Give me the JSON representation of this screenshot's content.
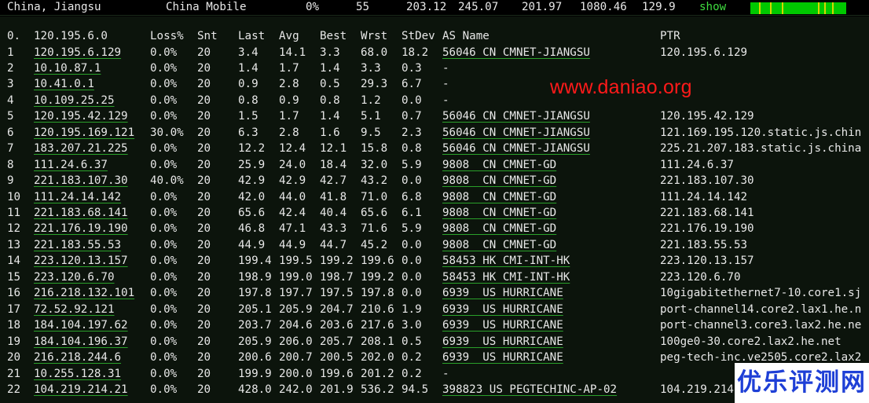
{
  "header": {
    "location": "China, Jiangsu",
    "isp": "China Mobile",
    "loss": "0%",
    "snt": "55",
    "last": "203.12",
    "avg": "245.07",
    "best": "201.97",
    "wrst": "1080.46",
    "stdev": "129.9",
    "show_label": "show"
  },
  "colors": {
    "background": "#000000",
    "panel": "#0c140c",
    "link_underline": "#2aa02a",
    "show_link": "#3fdc3f",
    "sparkline": "#00c800",
    "sparkline_spike": "#d6d600",
    "watermark": "#ff1a1a",
    "logo": "#1e3fd6"
  },
  "table": {
    "columns": {
      "hop": "0.",
      "host": "120.195.6.0",
      "loss": "Loss%",
      "snt": "Snt",
      "last": "Last",
      "avg": "Avg",
      "best": "Best",
      "wrst": "Wrst",
      "stdev": "StDev",
      "as": "AS Name",
      "ptr": "PTR"
    },
    "rows": [
      {
        "hop": "1",
        "host": "120.195.6.129",
        "loss": "0.0%",
        "snt": "20",
        "last": "3.4",
        "avg": "14.1",
        "best": "3.3",
        "wrst": "68.0",
        "stdev": "18.2",
        "as": "56046 CN CMNET-JIANGSU",
        "ptr": "120.195.6.129"
      },
      {
        "hop": "2",
        "host": "10.10.87.1",
        "loss": "0.0%",
        "snt": "20",
        "last": "1.4",
        "avg": "1.7",
        "best": "1.4",
        "wrst": "3.3",
        "stdev": "0.3",
        "as": "-",
        "ptr": ""
      },
      {
        "hop": "3",
        "host": "10.41.0.1",
        "loss": "0.0%",
        "snt": "20",
        "last": "0.9",
        "avg": "2.8",
        "best": "0.5",
        "wrst": "29.3",
        "stdev": "6.7",
        "as": "-",
        "ptr": ""
      },
      {
        "hop": "4",
        "host": "10.109.25.25",
        "loss": "0.0%",
        "snt": "20",
        "last": "0.8",
        "avg": "0.9",
        "best": "0.8",
        "wrst": "1.2",
        "stdev": "0.0",
        "as": "-",
        "ptr": ""
      },
      {
        "hop": "5",
        "host": "120.195.42.129",
        "loss": "0.0%",
        "snt": "20",
        "last": "1.5",
        "avg": "1.7",
        "best": "1.4",
        "wrst": "5.1",
        "stdev": "0.7",
        "as": "56046 CN CMNET-JIANGSU",
        "ptr": "120.195.42.129"
      },
      {
        "hop": "6",
        "host": "120.195.169.121",
        "loss": "30.0%",
        "snt": "20",
        "last": "6.3",
        "avg": "2.8",
        "best": "1.6",
        "wrst": "9.5",
        "stdev": "2.3",
        "as": "56046 CN CMNET-JIANGSU",
        "ptr": "121.169.195.120.static.js.chin"
      },
      {
        "hop": "7",
        "host": "183.207.21.225",
        "loss": "0.0%",
        "snt": "20",
        "last": "12.2",
        "avg": "12.4",
        "best": "12.1",
        "wrst": "15.8",
        "stdev": "0.8",
        "as": "56046 CN CMNET-JIANGSU",
        "ptr": "225.21.207.183.static.js.china"
      },
      {
        "hop": "8",
        "host": "111.24.6.37",
        "loss": "0.0%",
        "snt": "20",
        "last": "25.9",
        "avg": "24.0",
        "best": "18.4",
        "wrst": "32.0",
        "stdev": "5.9",
        "as": "9808  CN CMNET-GD",
        "ptr": "111.24.6.37"
      },
      {
        "hop": "9",
        "host": "221.183.107.30",
        "loss": "40.0%",
        "snt": "20",
        "last": "42.9",
        "avg": "42.9",
        "best": "42.7",
        "wrst": "43.2",
        "stdev": "0.0",
        "as": "9808  CN CMNET-GD",
        "ptr": "221.183.107.30"
      },
      {
        "hop": "10",
        "host": "111.24.14.142",
        "loss": "0.0%",
        "snt": "20",
        "last": "42.0",
        "avg": "44.0",
        "best": "41.8",
        "wrst": "71.0",
        "stdev": "6.8",
        "as": "9808  CN CMNET-GD",
        "ptr": "111.24.14.142"
      },
      {
        "hop": "11",
        "host": "221.183.68.141",
        "loss": "0.0%",
        "snt": "20",
        "last": "65.6",
        "avg": "42.4",
        "best": "40.4",
        "wrst": "65.6",
        "stdev": "6.1",
        "as": "9808  CN CMNET-GD",
        "ptr": "221.183.68.141"
      },
      {
        "hop": "12",
        "host": "221.176.19.190",
        "loss": "0.0%",
        "snt": "20",
        "last": "46.8",
        "avg": "47.1",
        "best": "43.3",
        "wrst": "71.6",
        "stdev": "5.9",
        "as": "9808  CN CMNET-GD",
        "ptr": "221.176.19.190"
      },
      {
        "hop": "13",
        "host": "221.183.55.53",
        "loss": "0.0%",
        "snt": "20",
        "last": "44.9",
        "avg": "44.9",
        "best": "44.7",
        "wrst": "45.2",
        "stdev": "0.0",
        "as": "9808  CN CMNET-GD",
        "ptr": "221.183.55.53"
      },
      {
        "hop": "14",
        "host": "223.120.13.157",
        "loss": "0.0%",
        "snt": "20",
        "last": "199.4",
        "avg": "199.5",
        "best": "199.2",
        "wrst": "199.6",
        "stdev": "0.0",
        "as": "58453 HK CMI-INT-HK",
        "ptr": "223.120.13.157"
      },
      {
        "hop": "15",
        "host": "223.120.6.70",
        "loss": "0.0%",
        "snt": "20",
        "last": "198.9",
        "avg": "199.0",
        "best": "198.7",
        "wrst": "199.2",
        "stdev": "0.0",
        "as": "58453 HK CMI-INT-HK",
        "ptr": "223.120.6.70"
      },
      {
        "hop": "16",
        "host": "216.218.132.101",
        "loss": "0.0%",
        "snt": "20",
        "last": "197.8",
        "avg": "197.7",
        "best": "197.5",
        "wrst": "197.8",
        "stdev": "0.0",
        "as": "6939  US HURRICANE",
        "ptr": "10gigabitethernet7-10.core1.sj"
      },
      {
        "hop": "17",
        "host": "72.52.92.121",
        "loss": "0.0%",
        "snt": "20",
        "last": "205.1",
        "avg": "205.9",
        "best": "204.7",
        "wrst": "210.6",
        "stdev": "1.9",
        "as": "6939  US HURRICANE",
        "ptr": "port-channel14.core2.lax1.he.n"
      },
      {
        "hop": "18",
        "host": "184.104.197.62",
        "loss": "0.0%",
        "snt": "20",
        "last": "203.7",
        "avg": "204.6",
        "best": "203.6",
        "wrst": "217.6",
        "stdev": "3.0",
        "as": "6939  US HURRICANE",
        "ptr": "port-channel3.core3.lax2.he.ne"
      },
      {
        "hop": "19",
        "host": "184.104.196.37",
        "loss": "0.0%",
        "snt": "20",
        "last": "205.9",
        "avg": "206.0",
        "best": "205.7",
        "wrst": "208.1",
        "stdev": "0.5",
        "as": "6939  US HURRICANE",
        "ptr": "100ge0-30.core2.lax2.he.net"
      },
      {
        "hop": "20",
        "host": "216.218.244.6",
        "loss": "0.0%",
        "snt": "20",
        "last": "200.6",
        "avg": "200.7",
        "best": "200.5",
        "wrst": "202.0",
        "stdev": "0.2",
        "as": "6939  US HURRICANE",
        "ptr": "peg-tech-inc.ve2505.core2.lax2"
      },
      {
        "hop": "21",
        "host": "10.255.128.31",
        "loss": "0.0%",
        "snt": "20",
        "last": "199.9",
        "avg": "200.0",
        "best": "199.6",
        "wrst": "201.2",
        "stdev": "0.2",
        "as": "-",
        "ptr": ""
      },
      {
        "hop": "22",
        "host": "104.219.214.21",
        "loss": "0.0%",
        "snt": "20",
        "last": "428.0",
        "avg": "242.0",
        "best": "201.9",
        "wrst": "536.2",
        "stdev": "94.5",
        "as": "398823 US PEGTECHINC-AP-02",
        "ptr": "104.219.214"
      }
    ]
  },
  "watermark": "www.daniao.org",
  "logo_text": "优乐评测网"
}
